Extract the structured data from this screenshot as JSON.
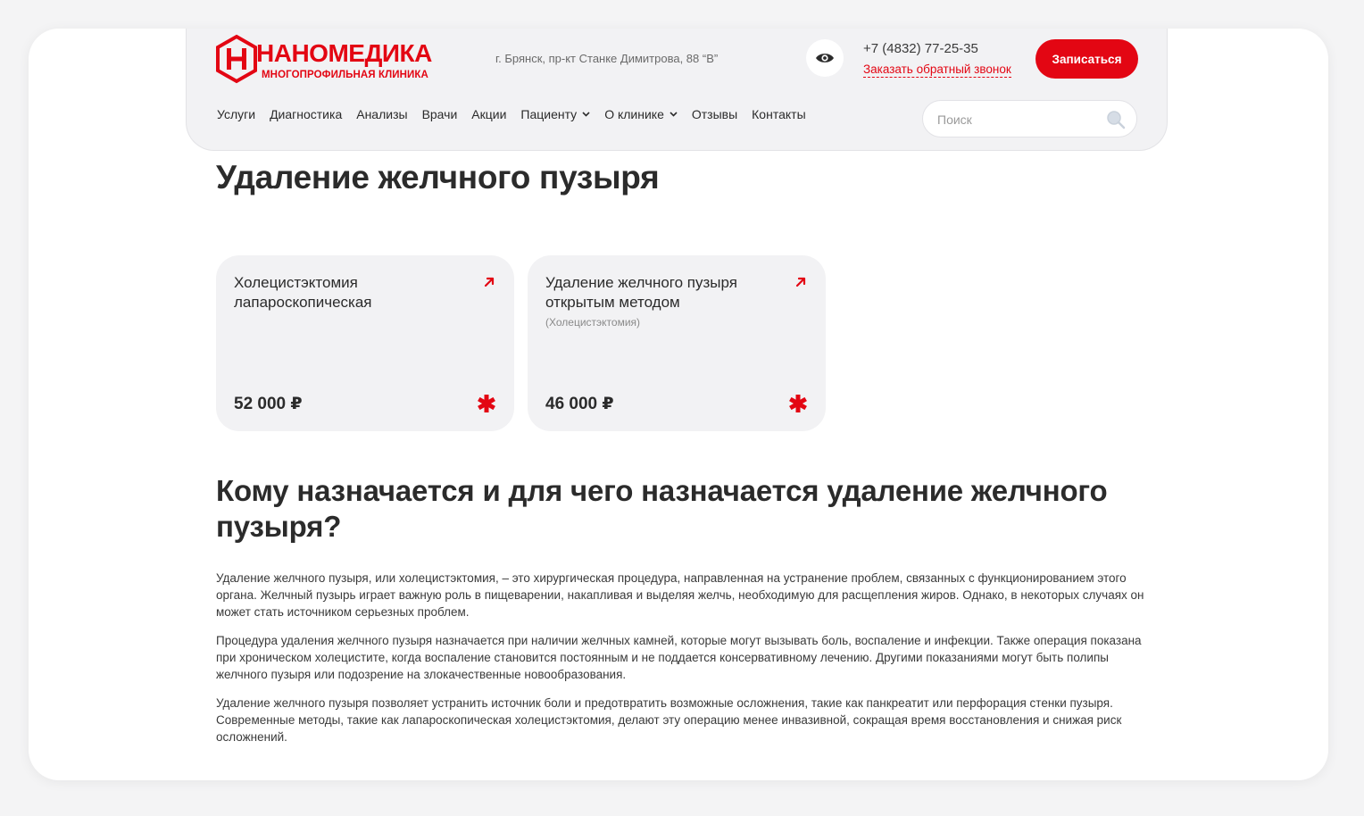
{
  "colors": {
    "accent": "#e30613",
    "page_bg": "#f4f4f5",
    "card_bg": "#f2f2f4",
    "text": "#2b2b2b"
  },
  "header": {
    "logo_name": "НАНОМЕДИКА",
    "logo_tagline": "многопрофильная клиника",
    "address": "г. Брянск, пр-кт Станке Димитрова, 88 “В”",
    "phone": "+7 (4832) 77-25-35",
    "callback_link": "Заказать обратный звонок",
    "cta_button": "Записаться",
    "search_placeholder": "Поиск",
    "nav": [
      {
        "label": "Услуги"
      },
      {
        "label": "Диагностика"
      },
      {
        "label": "Анализы"
      },
      {
        "label": "Врачи"
      },
      {
        "label": "Акции"
      },
      {
        "label": "Пациенту",
        "dropdown": true
      },
      {
        "label": "О клинике",
        "dropdown": true
      },
      {
        "label": "Отзывы"
      },
      {
        "label": "Контакты"
      }
    ],
    "icons": {
      "visibility": "eye-icon",
      "search": "search-icon",
      "dropdown": "chevron-down-icon"
    }
  },
  "main": {
    "title": "Удаление желчного пузыря",
    "cards": [
      {
        "title": "Холецистэктомия лапароскопическая",
        "note": "",
        "price": "52 000 ₽"
      },
      {
        "title": "Удаление желчного пузыря открытым методом",
        "note": "(Холецистэктомия)",
        "price": "46 000 ₽"
      }
    ],
    "section_title": "Кому назначается и для чего назначается удаление желчного пузыря?",
    "paragraphs": [
      "Удаление желчного пузыря, или холецистэктомия, – это хирургическая процедура, направленная на устранение проблем, связанных с функционированием этого органа. Желчный пузырь играет важную роль в пищеварении, накапливая и выделяя желчь, необходимую для расщепления жиров. Однако, в некоторых случаях он может стать источником серьезных проблем.",
      "Процедура удаления желчного пузыря назначается при наличии желчных камней, которые могут вызывать боль, воспаление и инфекции. Также операция показана при хроническом холецистите, когда воспаление становится постоянным и не поддается консервативному лечению. Другими показаниями могут быть полипы желчного пузыря или подозрение на злокачественные новообразования.",
      "Удаление желчного пузыря позволяет устранить источник боли и предотвратить возможные осложнения, такие как панкреатит или перфорация стенки пузыря. Современные методы, такие как лапароскопическая холецистэктомия, делают эту операцию менее инвазивной, сокращая время восстановления и снижая риск осложнений."
    ]
  }
}
